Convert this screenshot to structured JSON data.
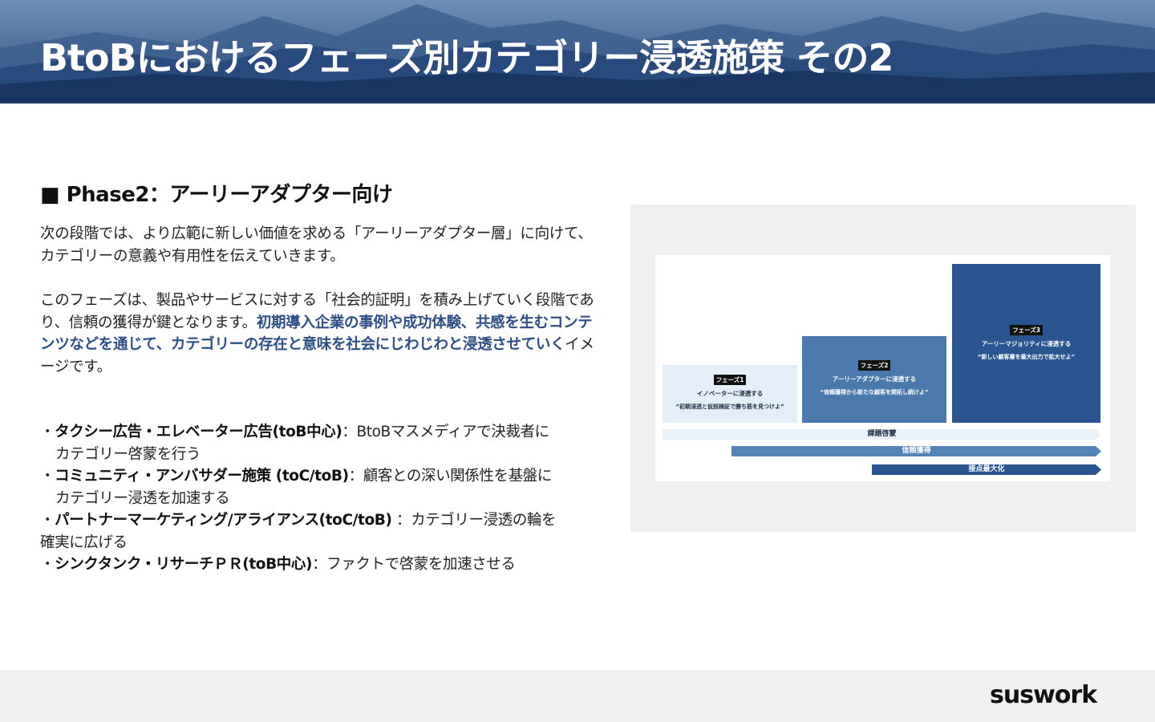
{
  "header": {
    "title": "BtoBにおけるフェーズ別カテゴリー浸透施策 その2"
  },
  "section": {
    "heading": "■ Phase2：アーリーアダプター向け",
    "paragraph1": "次の段階では、より広範に新しい価値を求める「アーリーアダプター層」に向けて、カテゴリーの意義や有用性を伝えていきます。",
    "paragraph2_start": "このフェーズは、製品やサービスに対する「社会的証明」を積み上げていく段階であり、信頼の獲得が鍵となります。",
    "paragraph2_highlight": "初期導入企業の事例や成功体験、共感を生むコンテンツなどを通じて、カテゴリーの存在と意味を社会にじわじわと浸透させていく",
    "paragraph2_end": "イメージです。"
  },
  "bullets": [
    {
      "marker": "・",
      "title": "タクシー広告・エレベーター広告(toB中心)",
      "text_a": "：BtoBマスメディアで決裁者に",
      "text_b": "カテゴリー啓蒙を行う"
    },
    {
      "marker": "・",
      "title": "コミュニティ・アンバサダー施策 (toC/toB)",
      "text_a": "：顧客との深い関係性を基盤に",
      "text_b": "カテゴリー浸透を加速する"
    },
    {
      "marker": "・",
      "title": "パートナーマーケティング/アライアンス(toC/toB)",
      "text_a": " ：カテゴリー浸透の輪を",
      "text_b": "確実に広げる"
    },
    {
      "marker": "・",
      "title": "シンクタンク・リサーチＰＲ(toB中心)",
      "text_a": "：ファクトで啓蒙を加速させる"
    }
  ],
  "diagram": {
    "phases": [
      {
        "tag": "フェーズ1",
        "line1": "イノベーターに浸透する",
        "line2": "“初期浸透と仮説検証で勝ち筋を見つけよ”"
      },
      {
        "tag": "フェーズ2",
        "line1": "アーリーアダプターに浸透する",
        "line2": "“信頼獲得から新たな顧客を開拓し続けよ”"
      },
      {
        "tag": "フェーズ3",
        "line1": "アーリーマジョリティに浸透する",
        "line2": "“新しい顧客層を最大出力で拡大せよ”"
      }
    ],
    "arrows": [
      "課題啓蒙",
      "信頼獲得",
      "接点最大化"
    ]
  },
  "footer": {
    "logo": "suswork"
  }
}
